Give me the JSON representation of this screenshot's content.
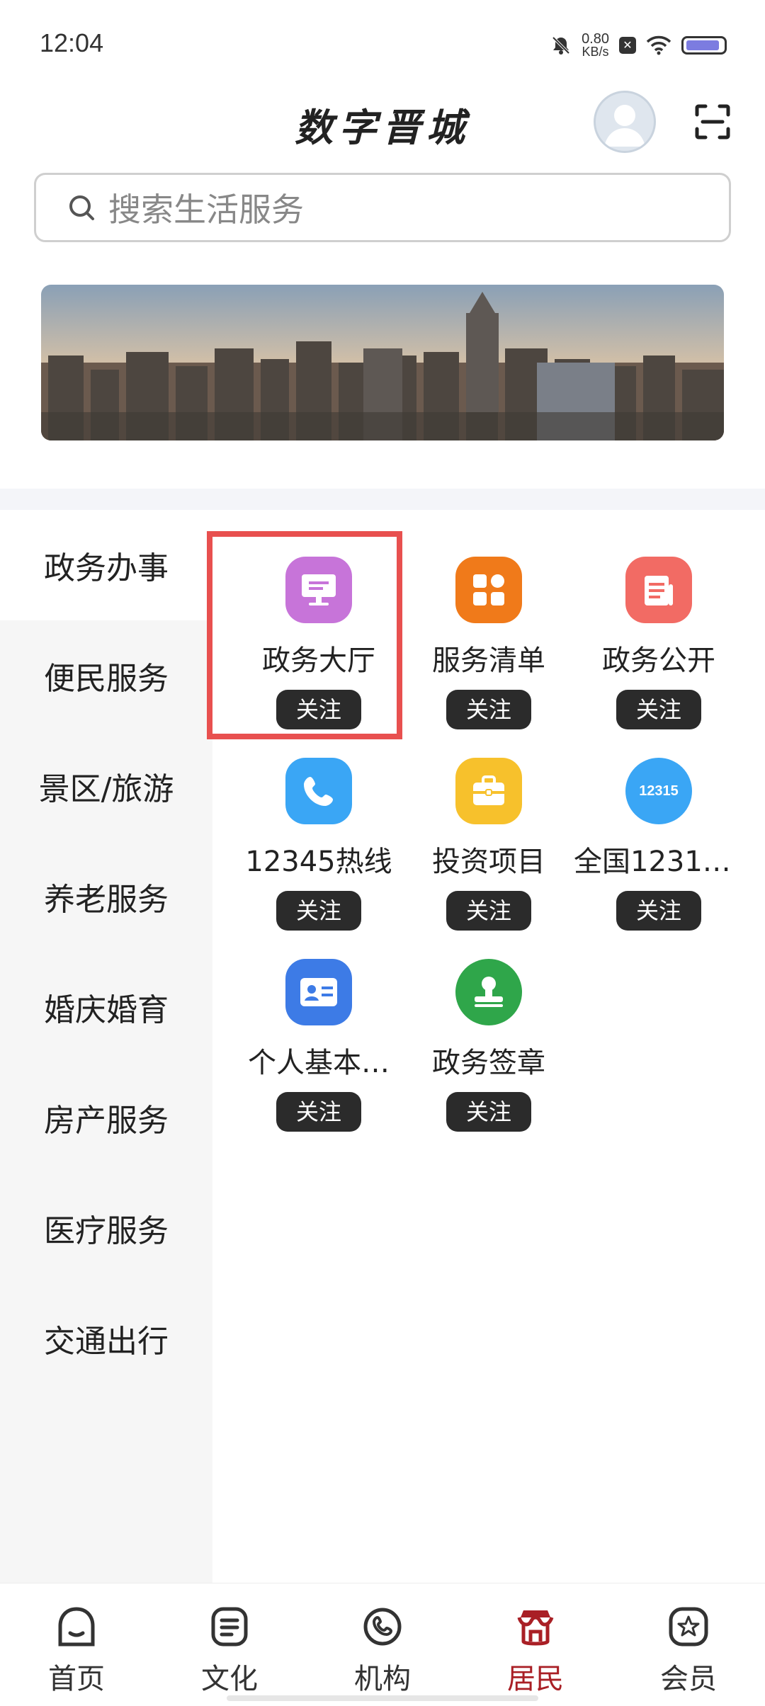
{
  "status_bar": {
    "time": "12:04",
    "net_speed": "0.80",
    "net_unit": "KB/s"
  },
  "header": {
    "title": "数字晋城"
  },
  "search": {
    "placeholder": "搜索生活服务"
  },
  "sidebar": {
    "items": [
      {
        "label": "政务办事",
        "active": true
      },
      {
        "label": "便民服务"
      },
      {
        "label": "景区/旅游"
      },
      {
        "label": "养老服务"
      },
      {
        "label": "婚庆婚育"
      },
      {
        "label": "房产服务"
      },
      {
        "label": "医疗服务"
      },
      {
        "label": "交通出行"
      }
    ]
  },
  "services": [
    {
      "label": "政务大厅",
      "icon": "monitor-icon",
      "color": "#c774d9",
      "follow": "关注"
    },
    {
      "label": "服务清单",
      "icon": "apps-icon",
      "color": "#f07a1a",
      "follow": "关注"
    },
    {
      "label": "政务公开",
      "icon": "document-icon",
      "color": "#f26b64",
      "follow": "关注"
    },
    {
      "label": "12345热线",
      "icon": "phone-icon",
      "color": "#3aa6f5",
      "follow": "关注"
    },
    {
      "label": "投资项目",
      "icon": "briefcase-icon",
      "color": "#f7c12c",
      "follow": "关注"
    },
    {
      "label": "全国12315…",
      "icon": "hotline-12315-icon",
      "icon_text": "12315",
      "color": "#3aa6f5",
      "follow": "关注"
    },
    {
      "label": "个人基本…",
      "icon": "id-card-icon",
      "color": "#3d7be6",
      "follow": "关注"
    },
    {
      "label": "政务签章",
      "icon": "stamp-icon",
      "color": "#2fa64a",
      "follow": "关注"
    }
  ],
  "bottom_nav": {
    "items": [
      {
        "label": "首页"
      },
      {
        "label": "文化"
      },
      {
        "label": "机构"
      },
      {
        "label": "居民",
        "active": true
      },
      {
        "label": "会员"
      }
    ]
  },
  "colors": {
    "accent": "#a91f25",
    "highlight": "#e8504f"
  }
}
